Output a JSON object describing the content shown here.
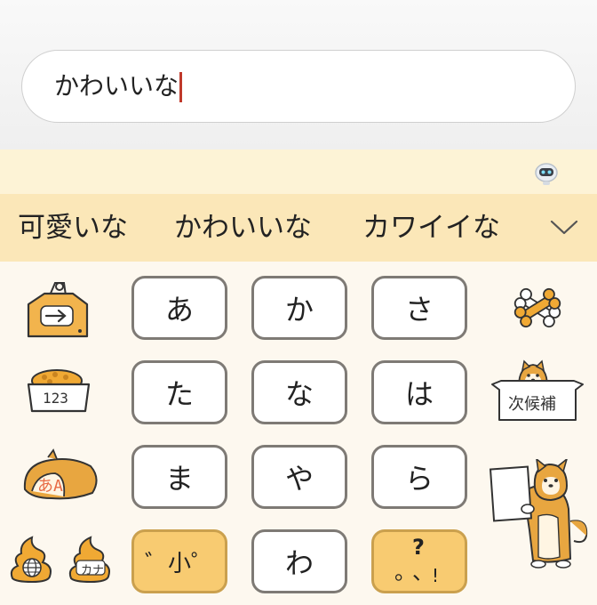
{
  "input": {
    "text": "かわいいな"
  },
  "candidates": [
    "可愛いな",
    "かわいいな",
    "カワイイな"
  ],
  "keys": {
    "a": "あ",
    "ka": "か",
    "sa": "さ",
    "ta": "た",
    "na": "な",
    "ha": "は",
    "ma": "ま",
    "ya": "や",
    "ra": "ら",
    "dakuten": "゛小゜",
    "wa": "わ"
  },
  "punct": {
    "question": "?",
    "period": "。",
    "comma": "、",
    "exclaim": "!"
  },
  "side": {
    "numbers_label": "123",
    "kana_label": "あA",
    "katakana_label": "カナ",
    "next_candidate_label": "次候補"
  },
  "icons": {
    "arrow": "right-arrow-icon",
    "bone": "bone-icon",
    "globe": "globe-icon",
    "robot": "robot-icon",
    "chevron": "chevron-down-icon"
  },
  "colors": {
    "candidate_bar": "#fbe7b8",
    "assist_bar": "#fdf3d6",
    "keyboard_bg": "#fdf8ef",
    "yellow_key": "#f8cb71",
    "caret": "#c0392b",
    "shiba": "#e8a640"
  }
}
